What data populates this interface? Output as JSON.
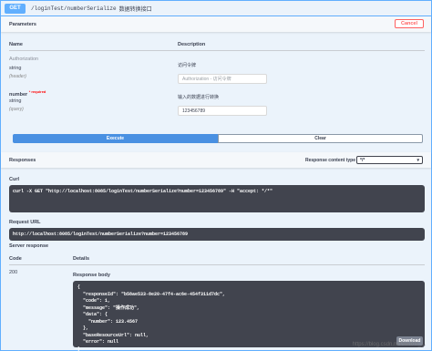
{
  "summary": {
    "method": "GET",
    "path": "/loginTest/numberSerialize",
    "description": "数据转换接口"
  },
  "parameters": {
    "header_title": "Parameters",
    "cancel_label": "Cancel",
    "col_name": "Name",
    "col_description": "Description",
    "items": [
      {
        "name": "Authorization",
        "required": "",
        "type": "string",
        "location": "(header)",
        "description": "访问令牌",
        "placeholder": "Authorization - 访问令牌",
        "value": ""
      },
      {
        "name": "number",
        "required": "* required",
        "type": "string",
        "location": "(query)",
        "description": "输入的数据进行转换",
        "placeholder": "",
        "value": "123456789"
      }
    ],
    "execute_label": "Execute",
    "clear_label": "Clear"
  },
  "responses": {
    "header_title": "Responses",
    "content_type_label": "Response content type",
    "content_type_value": "*/*",
    "curl_label": "Curl",
    "curl_command": "curl -X GET \"http://localhost:8085/loginTest/numberSerialize?number=123456789\" -H \"accept: */*\"",
    "request_url_label": "Request URL",
    "request_url": "http://localhost:8085/loginTest/numberSerialize?number=123456789",
    "server_response_label": "Server response",
    "col_code": "Code",
    "col_details": "Details",
    "code": "200",
    "body_label": "Response body",
    "body_lines": [
      "{",
      "  \"responseId\": \"b58ae533-8e20-47f4-ac6e-454f311d7dc\",",
      "  \"code\": 1,",
      "  \"message\": \"操作成功\",",
      "  \"data\": {",
      "    \"number\": 123.4567",
      "  },",
      "  \"baseResourceUrl\": null,",
      "  \"error\": null",
      "}"
    ],
    "download_label": "Download"
  },
  "watermark": "https://blog.csdn.net/weixin_...",
  "colors": {
    "get_blue": "#61affe",
    "block_bg": "#ebf3fb",
    "execute_blue": "#4990e2",
    "cancel_red": "#ff6060",
    "code_bg": "#41444e"
  }
}
